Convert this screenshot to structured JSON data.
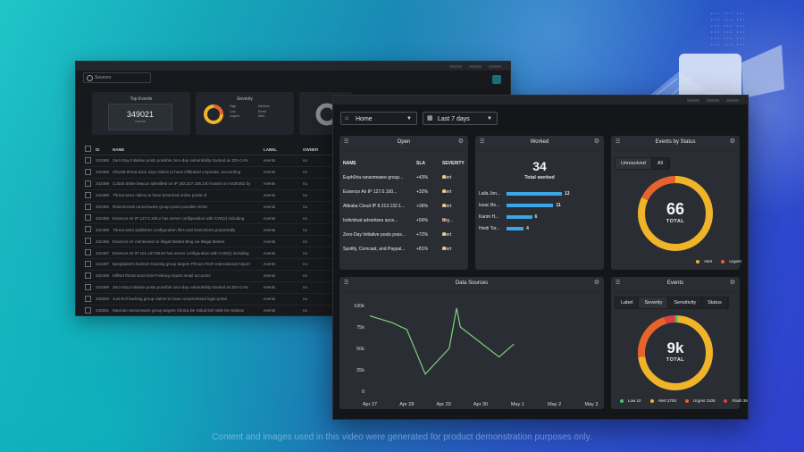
{
  "back_window": {
    "source_select": "Sources",
    "top_events": {
      "title": "Top Events",
      "value": "349021",
      "sub": "events"
    },
    "severity": {
      "title": "Severity",
      "legend": [
        "High",
        "Medium",
        "Low",
        "Event",
        "Urgent",
        "Alert"
      ]
    },
    "columns": [
      "ID",
      "NAME",
      "LABEL",
      "OWNER"
    ],
    "rows": [
      [
        "342486",
        "Zero-Day Initiative posts possible zero-day vulnerability tracked as ZDI-CAN",
        "events",
        "no"
      ],
      [
        "342489",
        "Ghost9 threat actor says claims to have infiltrated corporate, accounting",
        "events",
        "no"
      ],
      [
        "342489",
        "Cobalt Strike beacon identified on IP 192.227.236.140 hosted on AS36352 by",
        "events",
        "no"
      ],
      [
        "342490",
        "Threat actor claims to have breached online portal of",
        "events",
        "no"
      ],
      [
        "342492",
        "RansomHub ransomware group posts possible victim",
        "events",
        "no"
      ],
      [
        "342493",
        "Essence Air IP 127.0.100.x has server configuration with CVE(s) including",
        "events",
        "no"
      ],
      [
        "342495",
        "Threat actor publishes configuration files and instructions purportedly",
        "events",
        "no"
      ],
      [
        "342496",
        "Essence Air mentioned on illegal Market Blog via Illegal Market",
        "events",
        "no"
      ],
      [
        "342497",
        "Essence Air IP 101.187.88.84 has server configuration with CVE(s) including",
        "events",
        "no"
      ],
      [
        "342497",
        "Bangladeshi Darknet hacking group targets Phnom Penh International Airport",
        "events",
        "no"
      ],
      [
        "342498",
        "KillNet threat actor lists Freiburg Airport email accounts",
        "events",
        "no"
      ],
      [
        "342499",
        "Zero-Day Initiative posts possible zero-day vulnerability tracked as ZDI-CAN",
        "events",
        "no"
      ],
      [
        "342500",
        "Just Evil hacking group claims to have compromised login portal",
        "events",
        "no"
      ],
      [
        "342501",
        "Mexican ransomware group targets Clinica De Salud Del Valle De Salinas",
        "events",
        "no"
      ]
    ]
  },
  "front_window": {
    "home_select": "Home",
    "date_select": "Last 7 days",
    "open": {
      "title": "Open",
      "columns": [
        "NAME",
        "SLA",
        "SEVERITY"
      ],
      "rows": [
        {
          "name": "Euph0ria ransomware group...",
          "sla": "+43%",
          "severity": "Alert"
        },
        {
          "name": "Essence Air IP 127.0.100...",
          "sla": "+32%",
          "severity": "Alert"
        },
        {
          "name": "Alibaba Cloud IP 8.213.132.1...",
          "sla": "+36%",
          "severity": "Alert"
        },
        {
          "name": "Individual advertises acce...",
          "sla": "+56%",
          "severity": "Urg..."
        },
        {
          "name": "Zero-Day Initiative posts poss...",
          "sla": "+72%",
          "severity": "Alert"
        },
        {
          "name": "Spotify, Comcast, and Paypal...",
          "sla": "+81%",
          "severity": "Alert"
        }
      ]
    },
    "worked": {
      "title": "Worked",
      "total": "34",
      "total_label": "Total worked",
      "people": [
        {
          "name": "Laila Jon...",
          "count": 13
        },
        {
          "name": "Issac Be...",
          "count": 11
        },
        {
          "name": "Karim H...",
          "count": 6
        },
        {
          "name": "Heidi Tor...",
          "count": 4
        }
      ]
    },
    "events_by_status": {
      "title": "Events by Status",
      "tabs": [
        "Unresolved",
        "All"
      ],
      "total": "66",
      "total_label": "TOTAL",
      "legend": [
        {
          "label": "Alert",
          "color": "#f0b429",
          "fraction": 0.82
        },
        {
          "label": "Urgent",
          "color": "#e8632c",
          "fraction": 0.18
        }
      ]
    },
    "data_sources": {
      "title": "Data Sources"
    },
    "events": {
      "title": "Events",
      "tabs": [
        "Label",
        "Severity",
        "Sensitivity",
        "Status"
      ],
      "total": "9k",
      "total_label": "TOTAL",
      "legend": [
        {
          "label": "Low 10",
          "color": "#45c77a",
          "fraction": 0.01
        },
        {
          "label": "Alert 2793",
          "color": "#f0b429",
          "fraction": 0.72
        },
        {
          "label": "Urgent 1109",
          "color": "#e8632c",
          "fraction": 0.22
        },
        {
          "label": "Flash 39",
          "color": "#d94040",
          "fraction": 0.05
        }
      ]
    }
  },
  "chart_data": {
    "type": "line",
    "x": [
      "Apr 27",
      "Apr 28",
      "Apr 29",
      "Apr 30",
      "May 1",
      "May 2",
      "May 3"
    ],
    "series": [
      {
        "values": [
          [
            0,
            88000
          ],
          [
            0.6,
            80000
          ],
          [
            1.0,
            72000
          ],
          [
            1.5,
            20000
          ],
          [
            2.15,
            50000
          ],
          [
            2.35,
            97000
          ],
          [
            2.45,
            75000
          ],
          [
            3.5,
            40000
          ],
          [
            3.9,
            55000
          ]
        ]
      }
    ],
    "yticks": [
      "100k",
      "75k",
      "50k",
      "25k",
      "0"
    ],
    "ylim": [
      0,
      100000
    ],
    "color": "#7ed27a"
  },
  "disclaimer": "Content and images used in this video were generated for product demonstration purposes only."
}
